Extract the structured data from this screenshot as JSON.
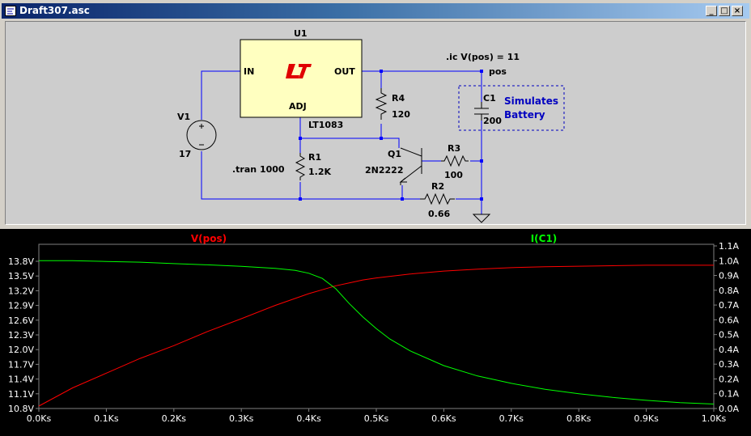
{
  "window": {
    "title": "Draft307.asc",
    "buttons": [
      "_",
      "□",
      "×"
    ]
  },
  "schematic": {
    "u1_name": "U1",
    "u1_part": "LT1083",
    "u1_pin_in": "IN",
    "u1_pin_out": "OUT",
    "u1_pin_adj": "ADJ",
    "directive_ic": ".ic V(pos) = 11",
    "directive_tran": ".tran 1000",
    "net_pos": "pos",
    "v1_name": "V1",
    "v1_value": "17",
    "r1_name": "R1",
    "r1_value": "1.2K",
    "r2_name": "R2",
    "r2_value": "0.66",
    "r3_name": "R3",
    "r3_value": "100",
    "r4_name": "R4",
    "r4_value": "120",
    "c1_name": "C1",
    "c1_value": "200",
    "q1_name": "Q1",
    "q1_part": "2N2222",
    "comment_line1": "Simulates",
    "comment_line2": "Battery",
    "colors": {
      "wire": "#0000ff",
      "part": "#000000",
      "comment": "#0000c0",
      "ic_fill": "#ffffc0",
      "logo": "#e00000"
    }
  },
  "chart_data": {
    "type": "line",
    "x_label_ticks": [
      "0.0Ks",
      "0.1Ks",
      "0.2Ks",
      "0.3Ks",
      "0.4Ks",
      "0.5Ks",
      "0.6Ks",
      "0.7Ks",
      "0.8Ks",
      "0.9Ks",
      "1.0Ks"
    ],
    "xlim": [
      0,
      1000
    ],
    "left_axis": {
      "ticks": [
        "10.8V",
        "11.1V",
        "11.4V",
        "11.7V",
        "12.0V",
        "12.3V",
        "12.6V",
        "12.9V",
        "13.2V",
        "13.5V",
        "13.8V"
      ],
      "ylim": [
        10.8,
        13.8
      ]
    },
    "right_axis": {
      "ticks": [
        "0.0A",
        "0.1A",
        "0.2A",
        "0.3A",
        "0.4A",
        "0.5A",
        "0.6A",
        "0.7A",
        "0.8A",
        "0.9A",
        "1.0A",
        "1.1A"
      ],
      "ylim": [
        0.0,
        1.1
      ]
    },
    "series": [
      {
        "name": "V(pos)",
        "axis": "left",
        "color": "#ff0000",
        "x": [
          0,
          50,
          100,
          150,
          200,
          250,
          300,
          350,
          400,
          420,
          440,
          460,
          480,
          500,
          550,
          600,
          650,
          700,
          750,
          800,
          850,
          900,
          950,
          1000
        ],
        "y": [
          10.85,
          11.22,
          11.52,
          11.82,
          12.08,
          12.37,
          12.63,
          12.9,
          13.14,
          13.22,
          13.3,
          13.36,
          13.42,
          13.46,
          13.54,
          13.6,
          13.64,
          13.67,
          13.69,
          13.7,
          13.71,
          13.72,
          13.72,
          13.72
        ]
      },
      {
        "name": "I(C1)",
        "axis": "right",
        "color": "#00ff00",
        "x": [
          0,
          50,
          100,
          150,
          200,
          250,
          300,
          350,
          380,
          400,
          420,
          440,
          460,
          480,
          500,
          520,
          550,
          600,
          650,
          700,
          750,
          800,
          850,
          900,
          950,
          1000
        ],
        "y": [
          1.0,
          1.0,
          0.995,
          0.99,
          0.98,
          0.972,
          0.962,
          0.948,
          0.935,
          0.915,
          0.88,
          0.81,
          0.71,
          0.62,
          0.54,
          0.47,
          0.39,
          0.29,
          0.22,
          0.17,
          0.13,
          0.1,
          0.075,
          0.055,
          0.04,
          0.03
        ]
      }
    ],
    "grid": false,
    "background": "#000000",
    "axis_color": "#808080",
    "tick_text_color": "#ffffff"
  }
}
